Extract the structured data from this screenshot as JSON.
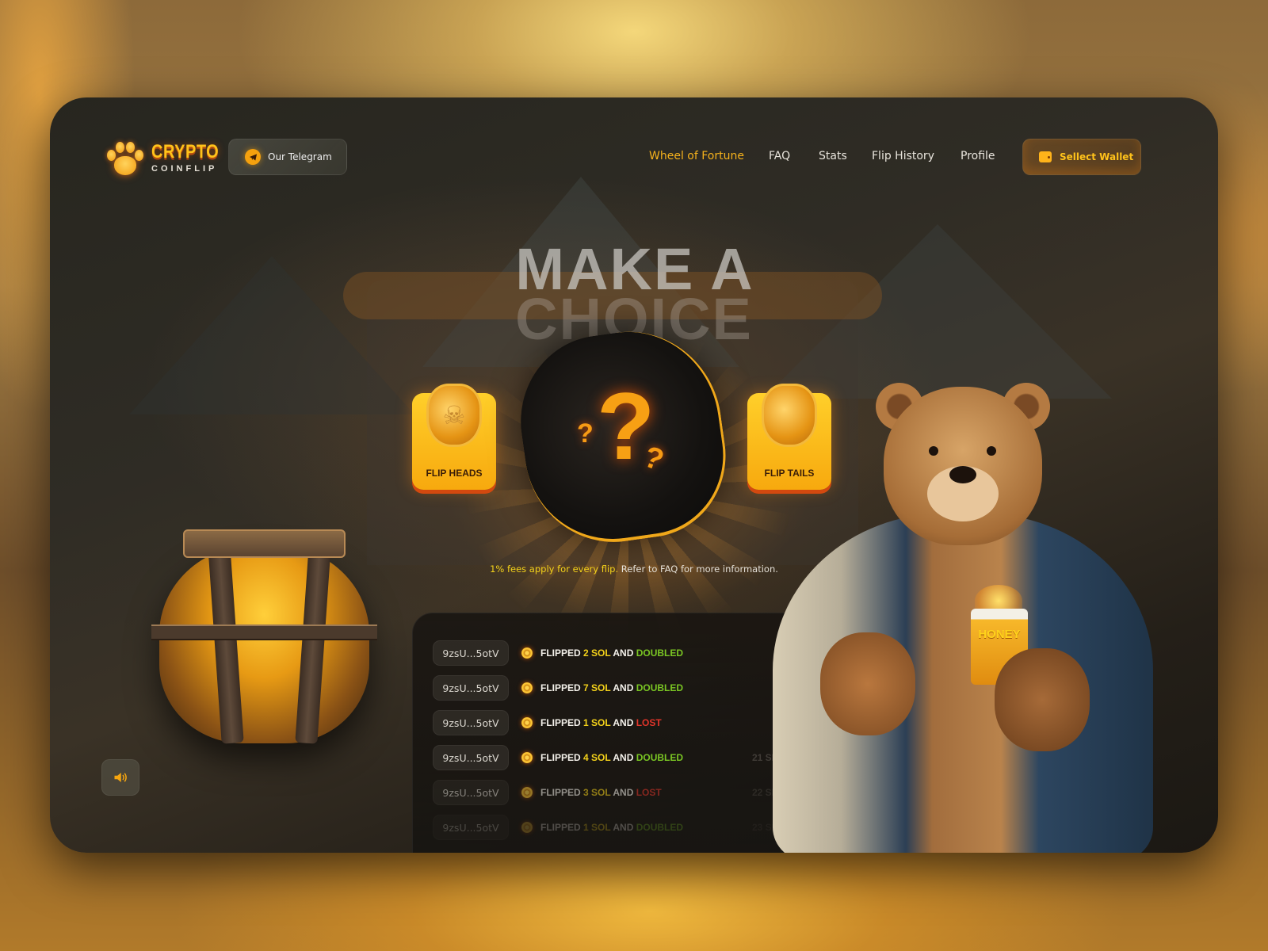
{
  "brand": {
    "name_top": "CRYPTO",
    "name_bottom": "COINFLIP",
    "accent_color": "#F6B21C",
    "logo_icon": "paw-icon"
  },
  "header": {
    "telegram_button": {
      "label": "Our Telegram",
      "icon": "telegram-icon"
    },
    "nav": [
      {
        "label": "Wheel of Fortune",
        "active": true
      },
      {
        "label": "FAQ",
        "active": false
      },
      {
        "label": "Stats",
        "active": false
      },
      {
        "label": "Flip History",
        "active": false
      },
      {
        "label": "Profile",
        "active": false
      }
    ],
    "wallet_button": {
      "label": "Sellect Wallet",
      "icon": "wallet-icon"
    }
  },
  "hero": {
    "title_line1": "MAKE A",
    "title_line2": "CHOICE",
    "mystery_glyph": "?"
  },
  "choices": {
    "heads": {
      "label": "FLIP HEADS",
      "icon": "skull-coin-icon"
    },
    "tails": {
      "label": "FLIP TAILS",
      "icon": "blank-coin-icon"
    }
  },
  "fee_note": {
    "highlight": "1% fees apply for every flip.",
    "rest": " Refer to FAQ for more information."
  },
  "history": [
    {
      "address": "9zsU...5otV",
      "prefix": "FLIPPED ",
      "amount": "2 SOL",
      "mid": " AND ",
      "result": "DOUBLED",
      "outcome": "doubled",
      "time": ""
    },
    {
      "address": "9zsU...5otV",
      "prefix": "FLIPPED ",
      "amount": "7 SOL",
      "mid": " AND ",
      "result": "DOUBLED",
      "outcome": "doubled",
      "time": ""
    },
    {
      "address": "9zsU...5otV",
      "prefix": "FLIPPED ",
      "amount": "1 SOL",
      "mid": " AND ",
      "result": "LOST",
      "outcome": "lost",
      "time": ""
    },
    {
      "address": "9zsU...5otV",
      "prefix": "FLIPPED ",
      "amount": "4 SOL",
      "mid": " AND ",
      "result": "DOUBLED",
      "outcome": "doubled",
      "time": "21 SEC AGO"
    },
    {
      "address": "9zsU...5otV",
      "prefix": "FLIPPED ",
      "amount": "3 SOL",
      "mid": " AND ",
      "result": "LOST",
      "outcome": "lost",
      "time": "22 SEC AGO"
    },
    {
      "address": "9zsU...5otV",
      "prefix": "FLIPPED ",
      "amount": "1 SOL",
      "mid": " AND ",
      "result": "DOUBLED",
      "outcome": "doubled",
      "time": "23 SEC AGO"
    }
  ],
  "mascot": {
    "mug_label": "HONEY"
  },
  "sound_button": {
    "icon": "speaker-icon"
  },
  "colors": {
    "doubled": "#7AC623",
    "lost": "#E2352A",
    "amount": "#F3D11A"
  }
}
